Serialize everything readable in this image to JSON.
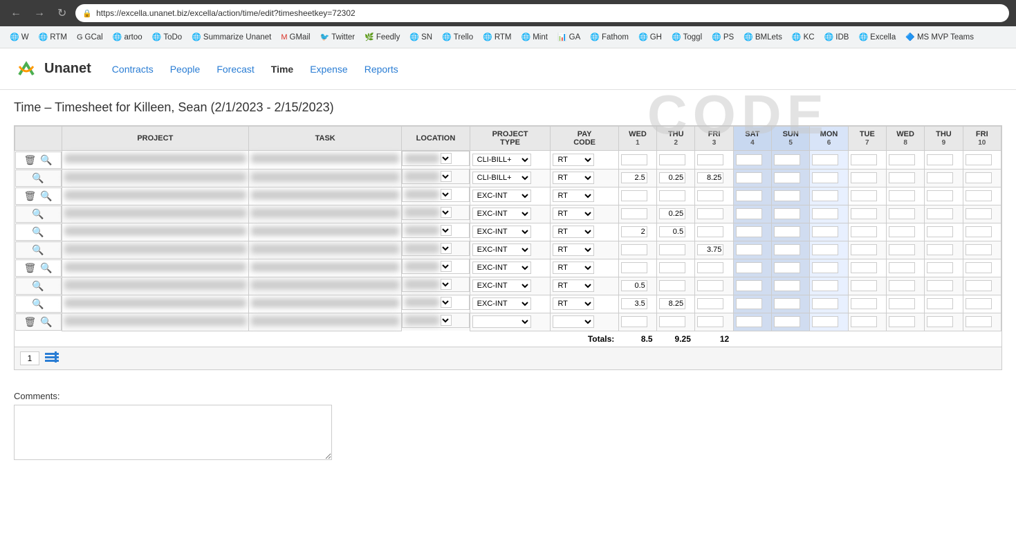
{
  "browser": {
    "url": "https://excella.unanet.biz/excella/action/time/edit?timesheetkey=72302",
    "nav_back": "←",
    "nav_forward": "→",
    "nav_refresh": "↻"
  },
  "bookmarks": [
    {
      "label": "W",
      "icon": "🌐"
    },
    {
      "label": "RTM",
      "icon": "🌐"
    },
    {
      "label": "GCal",
      "icon": "G"
    },
    {
      "label": "artoo",
      "icon": "🌐"
    },
    {
      "label": "ToDo",
      "icon": "🌐"
    },
    {
      "label": "Summarize Unanet",
      "icon": "🌐"
    },
    {
      "label": "GMail",
      "icon": "M"
    },
    {
      "label": "Twitter",
      "icon": "🐦"
    },
    {
      "label": "Feedly",
      "icon": "🌿"
    },
    {
      "label": "SN",
      "icon": "🌐"
    },
    {
      "label": "Trello",
      "icon": "🌐"
    },
    {
      "label": "RTM",
      "icon": "🌐"
    },
    {
      "label": "Mint",
      "icon": "🌐"
    },
    {
      "label": "GA",
      "icon": "📊"
    },
    {
      "label": "Fathom",
      "icon": "🌐"
    },
    {
      "label": "GH",
      "icon": "🌐"
    },
    {
      "label": "Toggl",
      "icon": "🌐"
    },
    {
      "label": "PS",
      "icon": "🌐"
    },
    {
      "label": "BMLets",
      "icon": "🌐"
    },
    {
      "label": "KC",
      "icon": "🌐"
    },
    {
      "label": "IDB",
      "icon": "🌐"
    },
    {
      "label": "Excella",
      "icon": "🌐"
    },
    {
      "label": "MS MVP Teams",
      "icon": "🔷"
    }
  ],
  "app": {
    "logo_text": "Unanet",
    "nav_items": [
      {
        "label": "Contracts",
        "active": false
      },
      {
        "label": "People",
        "active": false
      },
      {
        "label": "Forecast",
        "active": false
      },
      {
        "label": "Time",
        "active": true
      },
      {
        "label": "Expense",
        "active": false
      },
      {
        "label": "Reports",
        "active": false
      }
    ]
  },
  "page": {
    "title": "Time – Timesheet for Killeen, Sean (2/1/2023 - 2/15/2023)"
  },
  "table": {
    "headers": {
      "project": "PROJECT",
      "task": "TASK",
      "location": "LOCATION",
      "project_type": "PROJECT TYPE",
      "pay_code": "PAY CODE",
      "days": [
        {
          "label": "WED",
          "num": "1"
        },
        {
          "label": "THU",
          "num": "2"
        },
        {
          "label": "FRI",
          "num": "3"
        },
        {
          "label": "SAT",
          "num": "4",
          "weekend": true
        },
        {
          "label": "SUN",
          "num": "5",
          "weekend": true
        },
        {
          "label": "MON",
          "num": "6"
        },
        {
          "label": "TUE",
          "num": "7"
        },
        {
          "label": "WED",
          "num": "8"
        },
        {
          "label": "THU",
          "num": "9"
        },
        {
          "label": "FRI",
          "num": "10"
        }
      ]
    },
    "rows": [
      {
        "has_delete": true,
        "has_search": true,
        "project_type": "CLI-BILL+",
        "pay_code": "RT",
        "values": [
          "",
          "",
          "",
          "",
          "",
          "",
          "",
          "",
          "",
          ""
        ]
      },
      {
        "has_delete": false,
        "has_search": true,
        "project_type": "CLI-BILL+",
        "pay_code": "RT",
        "values": [
          "2.5",
          "0.25",
          "8.25",
          "",
          "",
          "",
          "",
          "",
          "",
          ""
        ]
      },
      {
        "has_delete": true,
        "has_search": true,
        "project_type": "EXC-INT",
        "pay_code": "RT",
        "values": [
          "",
          "",
          "",
          "",
          "",
          "",
          "",
          "",
          "",
          ""
        ]
      },
      {
        "has_delete": false,
        "has_search": true,
        "project_type": "EXC-INT",
        "pay_code": "RT",
        "values": [
          "",
          "0.25",
          "",
          "",
          "",
          "",
          "",
          "",
          "",
          ""
        ]
      },
      {
        "has_delete": false,
        "has_search": true,
        "project_type": "EXC-INT",
        "pay_code": "RT",
        "values": [
          "2",
          "0.5",
          "",
          "",
          "",
          "",
          "",
          "",
          "",
          ""
        ]
      },
      {
        "has_delete": false,
        "has_search": true,
        "project_type": "EXC-INT",
        "pay_code": "RT",
        "values": [
          "",
          "",
          "3.75",
          "",
          "",
          "",
          "",
          "",
          "",
          ""
        ]
      },
      {
        "has_delete": true,
        "has_search": true,
        "project_type": "EXC-INT",
        "pay_code": "RT",
        "values": [
          "",
          "",
          "",
          "",
          "",
          "",
          "",
          "",
          "",
          ""
        ]
      },
      {
        "has_delete": false,
        "has_search": true,
        "project_type": "EXC-INT",
        "pay_code": "RT",
        "values": [
          "0.5",
          "",
          "",
          "",
          "",
          "",
          "",
          "",
          "",
          ""
        ]
      },
      {
        "has_delete": false,
        "has_search": true,
        "project_type": "EXC-INT",
        "pay_code": "RT",
        "values": [
          "3.5",
          "8.25",
          "",
          "",
          "",
          "",
          "",
          "",
          "",
          ""
        ]
      },
      {
        "has_delete": true,
        "has_search": true,
        "project_type": "",
        "pay_code": "",
        "values": [
          "",
          "",
          "",
          "",
          "",
          "",
          "",
          "",
          "",
          ""
        ]
      }
    ],
    "totals": {
      "label": "Totals:",
      "values": [
        "8.5",
        "9.25",
        "12",
        "",
        "",
        "",
        "",
        "",
        "",
        ""
      ]
    }
  },
  "bottom_bar": {
    "page_num": "1"
  },
  "comments": {
    "label": "Comments:",
    "placeholder": ""
  },
  "code_watermark": "CODE"
}
